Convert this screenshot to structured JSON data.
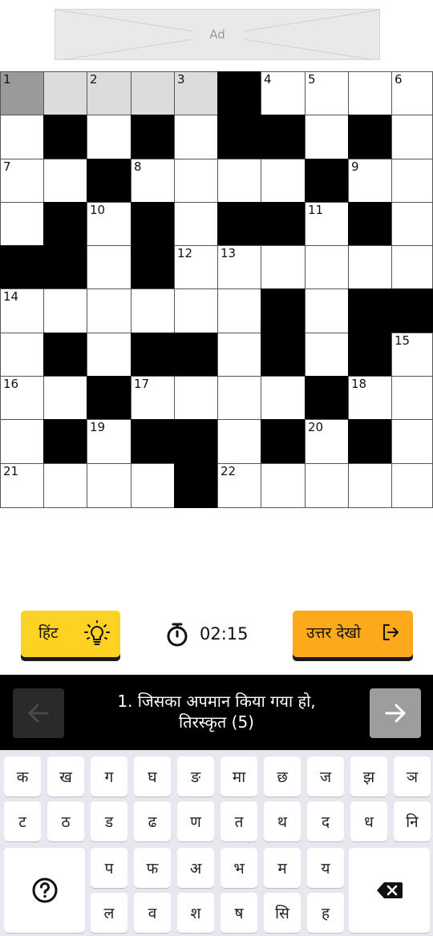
{
  "ad": {
    "label": "Ad"
  },
  "grid": {
    "cells": [
      [
        {
          "t": "active",
          "n": "1"
        },
        {
          "t": "hl",
          "n": ""
        },
        {
          "t": "hl",
          "n": "2"
        },
        {
          "t": "hl",
          "n": ""
        },
        {
          "t": "hl",
          "n": "3"
        },
        {
          "t": "black",
          "n": ""
        },
        {
          "t": "white",
          "n": "4"
        },
        {
          "t": "white",
          "n": "5"
        },
        {
          "t": "white",
          "n": ""
        },
        {
          "t": "white",
          "n": "6"
        }
      ],
      [
        {
          "t": "white",
          "n": ""
        },
        {
          "t": "black",
          "n": ""
        },
        {
          "t": "white",
          "n": ""
        },
        {
          "t": "black",
          "n": ""
        },
        {
          "t": "white",
          "n": ""
        },
        {
          "t": "black",
          "n": ""
        },
        {
          "t": "black",
          "n": ""
        },
        {
          "t": "white",
          "n": ""
        },
        {
          "t": "black",
          "n": ""
        },
        {
          "t": "white",
          "n": ""
        }
      ],
      [
        {
          "t": "white",
          "n": "7"
        },
        {
          "t": "white",
          "n": ""
        },
        {
          "t": "black",
          "n": ""
        },
        {
          "t": "white",
          "n": "8"
        },
        {
          "t": "white",
          "n": ""
        },
        {
          "t": "white",
          "n": ""
        },
        {
          "t": "white",
          "n": ""
        },
        {
          "t": "black",
          "n": ""
        },
        {
          "t": "white",
          "n": "9"
        },
        {
          "t": "white",
          "n": ""
        }
      ],
      [
        {
          "t": "white",
          "n": ""
        },
        {
          "t": "black",
          "n": ""
        },
        {
          "t": "white",
          "n": "10"
        },
        {
          "t": "black",
          "n": ""
        },
        {
          "t": "white",
          "n": ""
        },
        {
          "t": "black",
          "n": ""
        },
        {
          "t": "black",
          "n": ""
        },
        {
          "t": "white",
          "n": "11"
        },
        {
          "t": "black",
          "n": ""
        },
        {
          "t": "white",
          "n": ""
        }
      ],
      [
        {
          "t": "black",
          "n": ""
        },
        {
          "t": "black",
          "n": ""
        },
        {
          "t": "white",
          "n": ""
        },
        {
          "t": "black",
          "n": ""
        },
        {
          "t": "white",
          "n": "12"
        },
        {
          "t": "white",
          "n": "13"
        },
        {
          "t": "white",
          "n": ""
        },
        {
          "t": "white",
          "n": ""
        },
        {
          "t": "white",
          "n": ""
        },
        {
          "t": "white",
          "n": ""
        }
      ],
      [
        {
          "t": "white",
          "n": "14"
        },
        {
          "t": "white",
          "n": ""
        },
        {
          "t": "white",
          "n": ""
        },
        {
          "t": "white",
          "n": ""
        },
        {
          "t": "white",
          "n": ""
        },
        {
          "t": "white",
          "n": ""
        },
        {
          "t": "black",
          "n": ""
        },
        {
          "t": "white",
          "n": ""
        },
        {
          "t": "black",
          "n": ""
        },
        {
          "t": "black",
          "n": ""
        }
      ],
      [
        {
          "t": "white",
          "n": ""
        },
        {
          "t": "black",
          "n": ""
        },
        {
          "t": "white",
          "n": ""
        },
        {
          "t": "black",
          "n": ""
        },
        {
          "t": "black",
          "n": ""
        },
        {
          "t": "white",
          "n": ""
        },
        {
          "t": "black",
          "n": ""
        },
        {
          "t": "white",
          "n": ""
        },
        {
          "t": "black",
          "n": ""
        },
        {
          "t": "white",
          "n": "15"
        }
      ],
      [
        {
          "t": "white",
          "n": "16"
        },
        {
          "t": "white",
          "n": ""
        },
        {
          "t": "black",
          "n": ""
        },
        {
          "t": "white",
          "n": "17"
        },
        {
          "t": "white",
          "n": ""
        },
        {
          "t": "white",
          "n": ""
        },
        {
          "t": "white",
          "n": ""
        },
        {
          "t": "black",
          "n": ""
        },
        {
          "t": "white",
          "n": "18"
        },
        {
          "t": "white",
          "n": ""
        }
      ],
      [
        {
          "t": "white",
          "n": ""
        },
        {
          "t": "black",
          "n": ""
        },
        {
          "t": "white",
          "n": "19"
        },
        {
          "t": "black",
          "n": ""
        },
        {
          "t": "black",
          "n": ""
        },
        {
          "t": "white",
          "n": ""
        },
        {
          "t": "black",
          "n": ""
        },
        {
          "t": "white",
          "n": "20"
        },
        {
          "t": "black",
          "n": ""
        },
        {
          "t": "white",
          "n": ""
        }
      ],
      [
        {
          "t": "white",
          "n": "21"
        },
        {
          "t": "white",
          "n": ""
        },
        {
          "t": "white",
          "n": ""
        },
        {
          "t": "white",
          "n": ""
        },
        {
          "t": "black",
          "n": ""
        },
        {
          "t": "white",
          "n": "22"
        },
        {
          "t": "white",
          "n": ""
        },
        {
          "t": "white",
          "n": ""
        },
        {
          "t": "white",
          "n": ""
        },
        {
          "t": "white",
          "n": ""
        }
      ]
    ]
  },
  "controls": {
    "hint_label": "हिंट",
    "hint_icon": "lightbulb-icon",
    "timer": "02:15",
    "timer_icon": "stopwatch-icon",
    "answer_label": "उत्तर देखो",
    "answer_icon": "exit-icon",
    "hint_color": "#fdd222",
    "answer_color": "#fda91c"
  },
  "clue": {
    "line1": "1. जिसका अपमान किया गया हो,",
    "line2": "तिरस्कृत (5)",
    "prev_icon": "arrow-left-icon",
    "next_icon": "arrow-right-icon"
  },
  "keyboard": {
    "row1": [
      "क",
      "ख",
      "ग",
      "घ",
      "ङ",
      "मा",
      "छ",
      "ज",
      "झ",
      "ञ"
    ],
    "row2": [
      "ट",
      "ठ",
      "ड",
      "ढ",
      "ण",
      "त",
      "थ",
      "द",
      "ध",
      "नि"
    ],
    "row3": [
      "प",
      "फ",
      "अ",
      "भ",
      "म",
      "य"
    ],
    "row4": [
      "ल",
      "व",
      "श",
      "ष",
      "सि",
      "ह"
    ],
    "help_icon": "help-icon",
    "backspace_icon": "backspace-icon"
  }
}
